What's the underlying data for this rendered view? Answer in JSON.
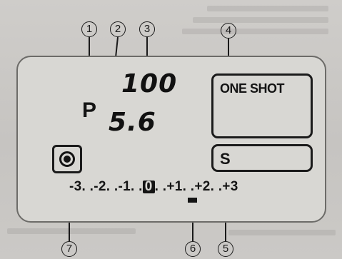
{
  "callouts": [
    "1",
    "2",
    "3",
    "4",
    "5",
    "6",
    "7"
  ],
  "display": {
    "mode": "P",
    "shutter_speed": "100",
    "aperture": "5.6",
    "af_mode": "ONE SHOT",
    "drive_mode": "S",
    "metering_icon": "evaluative-metering-icon",
    "exposure_scale": {
      "left": "-3. .-2. .-1. .",
      "zero": "0",
      "right": ". .+1. .+2. .+3"
    },
    "exposure_level": 0
  }
}
